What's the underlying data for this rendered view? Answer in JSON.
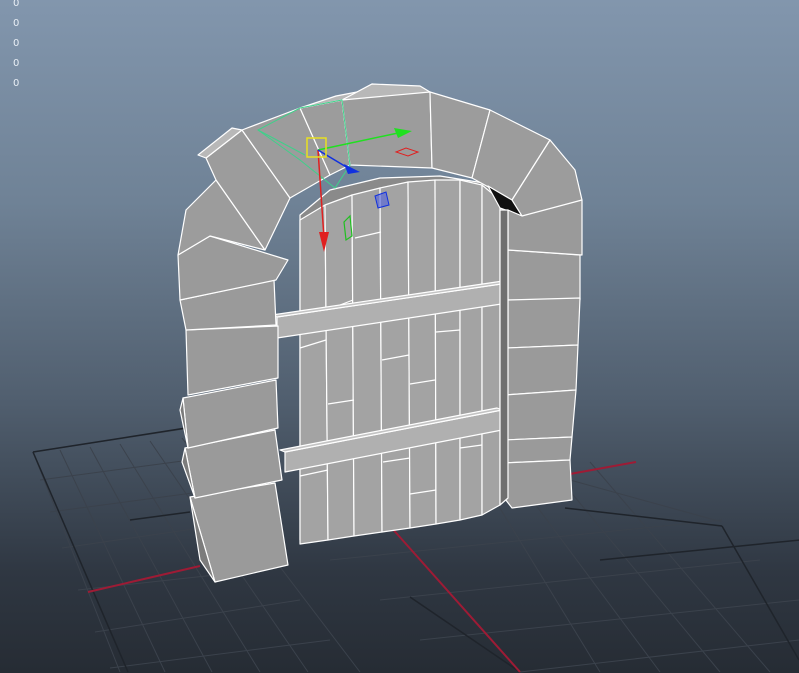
{
  "app": {
    "view": "perspective-viewport",
    "scene_object": "stone-arch-wooden-door"
  },
  "hud": {
    "values": [
      "0",
      "0",
      "0",
      "0",
      "0"
    ]
  },
  "colors": {
    "background_top": "#8296ad",
    "background_bottom": "#262c34",
    "grid_line": "#3b424c",
    "grid_axis": "#9e1b35",
    "mesh_face": "#9a9a9a",
    "mesh_edge": "#ffffff",
    "gizmo_x": "#e02020",
    "gizmo_y": "#20e020",
    "gizmo_z": "#1030e0",
    "gizmo_center": "#e8e020",
    "selection_outline": "#3fd08a"
  },
  "icons": {
    "move_gizmo": "move-manipulator-icon",
    "gizmo_center": "gizmo-center-handle-icon"
  }
}
